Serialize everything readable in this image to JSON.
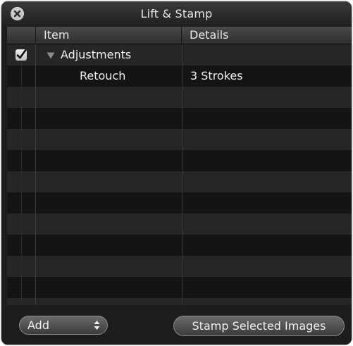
{
  "window": {
    "title": "Lift & Stamp"
  },
  "columns": {
    "item": "Item",
    "details": "Details"
  },
  "rows": [
    {
      "checked": true,
      "expanded": true,
      "item": "Adjustments",
      "details": ""
    },
    {
      "checked": false,
      "item": "Retouch",
      "details": "3 Strokes"
    }
  ],
  "footer": {
    "popup_value": "Add",
    "stamp_button": "Stamp Selected Images"
  },
  "icons": {
    "close": "close-icon",
    "checkbox": "checkmark-icon",
    "disclosure": "disclosure-triangle-down-icon",
    "popup_arrows": "up-down-arrows-icon"
  }
}
